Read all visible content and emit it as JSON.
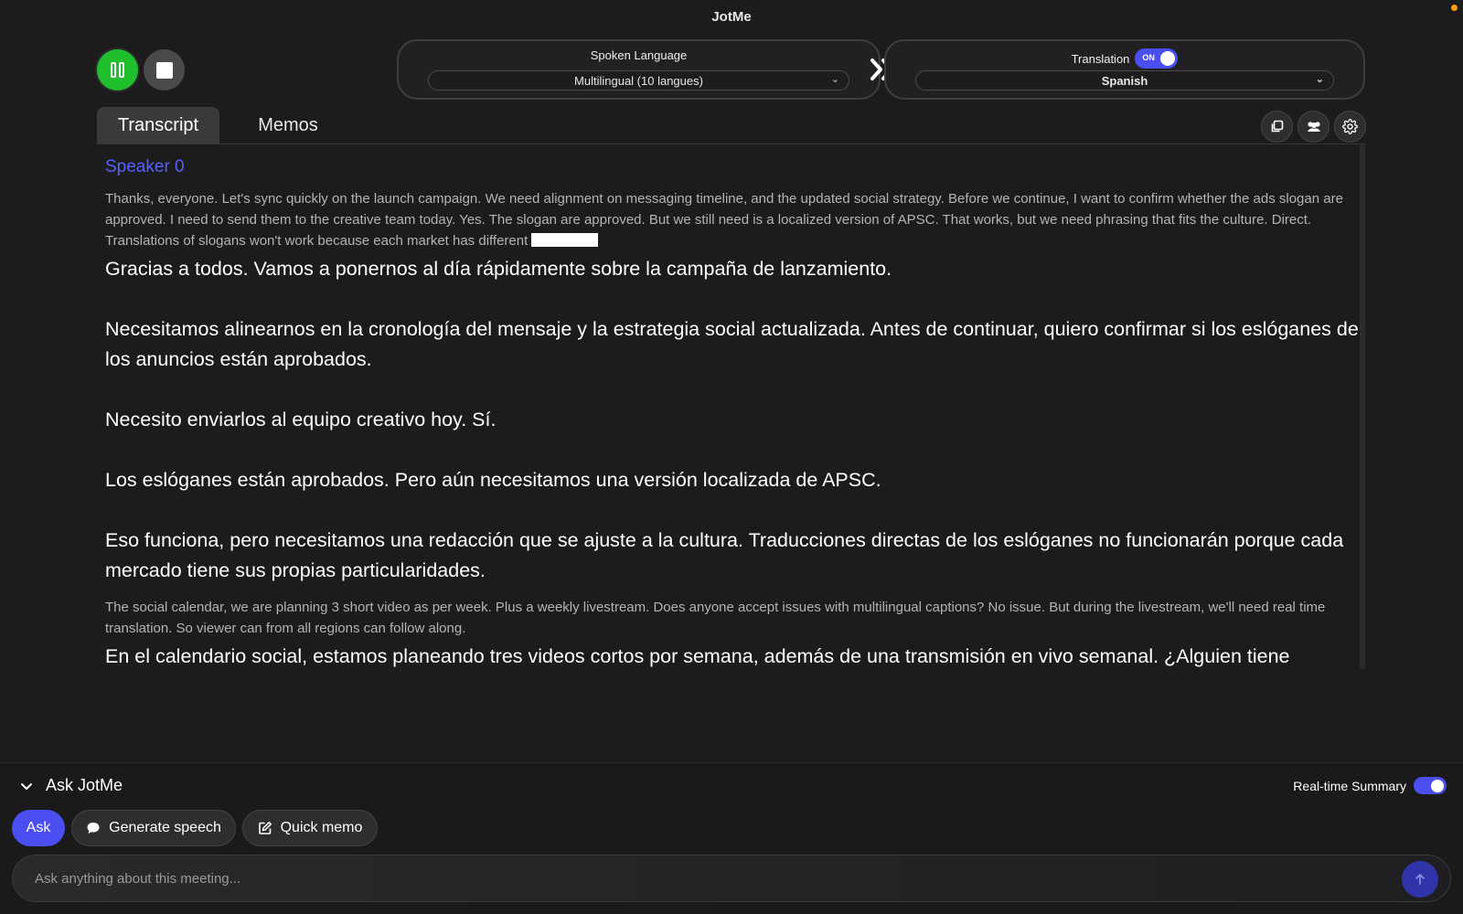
{
  "window": {
    "title": "JotMe"
  },
  "controls": {
    "pause_icon": "pause-icon",
    "stop_icon": "stop-icon"
  },
  "spoken_language": {
    "title": "Spoken Language",
    "selected": "Multilingual (10 langues)"
  },
  "translation": {
    "title": "Translation",
    "toggle_label": "ON",
    "toggle_on": true,
    "selected": "Spanish"
  },
  "tabs": [
    {
      "label": "Transcript",
      "active": true
    },
    {
      "label": "Memos",
      "active": false
    }
  ],
  "toolbar_icons": [
    "copy-icon",
    "people-icon",
    "gear-icon"
  ],
  "transcript": {
    "speaker": "Speaker 0",
    "block1_original": "Thanks, everyone. Let's sync quickly on the launch campaign. We need alignment on messaging timeline, and the updated social strategy. Before we continue, I want to confirm whether the ads slogan are approved. I need to send them to the creative team today. Yes. The slogan are approved. But we still need is a localized version of APSC. That works, but we need phrasing that fits the culture. Direct. Translations of slogans won't work because each market has different",
    "block1_translations": [
      "Gracias a todos. Vamos a ponernos al día rápidamente sobre la campaña de lanzamiento.",
      "Necesitamos alinearnos en la cronología del mensaje y la estrategia social actualizada. Antes de continuar, quiero confirmar si los eslóganes de los anuncios están aprobados.",
      "Necesito enviarlos al equipo creativo hoy. Sí.",
      "Los eslóganes están aprobados. Pero aún necesitamos una versión localizada de APSC.",
      "Eso funciona, pero necesitamos una redacción que se ajuste a la cultura. Traducciones directas de los eslóganes no funcionarán porque cada mercado tiene sus propias particularidades."
    ],
    "block2_original": "The social calendar, we are planning 3 short video as per week. Plus a weekly livestream. Does anyone accept issues with multilingual captions? No issue. But during the livestream, we'll need real time translation. So viewer can from all regions can follow along.",
    "block2_translations": [
      "En el calendario social, estamos planeando tres videos cortos por semana, además de una transmisión en vivo semanal. ¿Alguien tiene problemas con los subtítulos multilingües?"
    ]
  },
  "ask_panel": {
    "title": "Ask JotMe",
    "realtime_summary_label": "Real-time Summary",
    "realtime_summary_on": true,
    "buttons": {
      "ask": "Ask",
      "generate_speech": "Generate speech",
      "quick_memo": "Quick memo"
    },
    "input_placeholder": "Ask anything about this meeting..."
  },
  "colors": {
    "accent": "#4b4ef0",
    "record_green": "#1fbf2e",
    "speaker_blue": "#5560ff",
    "background": "#1c1c1d"
  }
}
